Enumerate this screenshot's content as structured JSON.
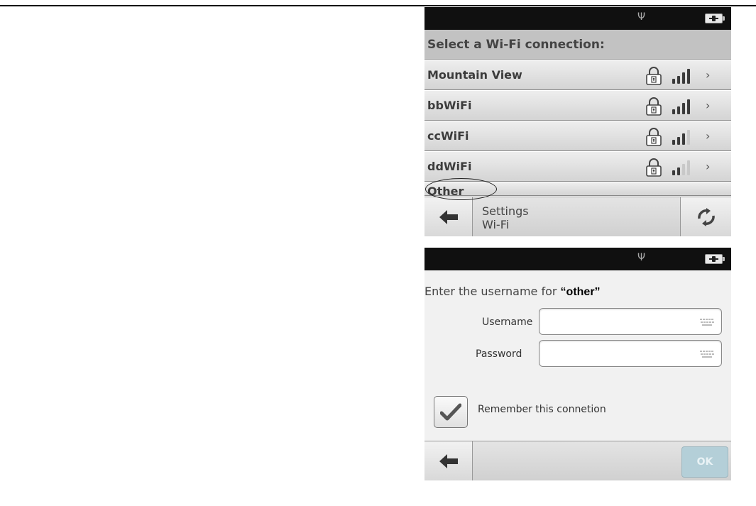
{
  "wifi_list_screen": {
    "header": "Select a Wi-Fi connection:",
    "networks": [
      {
        "name": "Mountain View",
        "secured": true,
        "signal_bars": 4
      },
      {
        "name": "bbWiFi",
        "secured": true,
        "signal_bars": 4
      },
      {
        "name": "ccWiFi",
        "secured": true,
        "signal_bars": 3
      },
      {
        "name": "ddWiFi",
        "secured": true,
        "signal_bars": 2
      },
      {
        "name": "Other"
      }
    ],
    "breadcrumb": [
      "Settings",
      "Wi-Fi"
    ],
    "icons": {
      "status_antenna": "antenna-icon",
      "battery": "battery-charging-icon",
      "back": "back-arrow-icon",
      "refresh": "refresh-icon",
      "lock": "lock-icon",
      "signal": "signal-strength-icon",
      "chevron": "chevron-right-icon"
    }
  },
  "credentials_screen": {
    "prompt_prefix": "Enter the username for ",
    "prompt_target": "“other”",
    "username_label": "Username",
    "username_value": "",
    "password_label": "Password",
    "password_value": "",
    "remember_label": "Remember this connetion",
    "remember_checked": true,
    "ok_label": "OK",
    "icons": {
      "back": "back-arrow-icon",
      "keyboard": "keyboard-icon",
      "checkmark": "checkmark-icon"
    }
  },
  "colors": {
    "status_bar": "#101010",
    "list_header_bg": "#c2c2c2",
    "ok_button_disabled": "#b4cfd8",
    "signal_active": "#3a3a3a",
    "signal_inactive": "#c8c8c8"
  }
}
